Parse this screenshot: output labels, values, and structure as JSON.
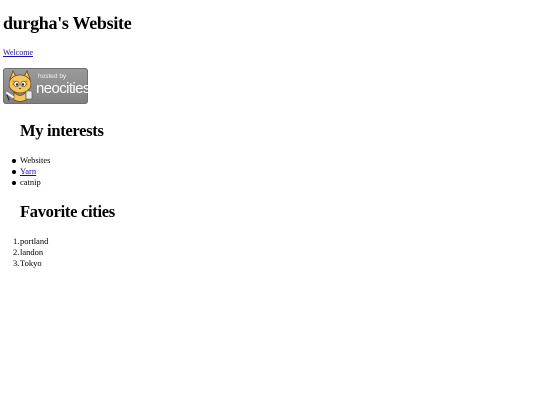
{
  "site": {
    "title": "durgha's Website",
    "welcome_link": "Welcome"
  },
  "badge": {
    "hosted_text": "hosted by",
    "brand_text": "neocities",
    "icon": "neocities-cat-icon",
    "background": "#8c8c8c"
  },
  "interests": {
    "heading": "My interests",
    "items": [
      {
        "label": "Websites",
        "link": false
      },
      {
        "label": "Yarn",
        "link": true
      },
      {
        "label": "catnip",
        "link": false
      }
    ]
  },
  "cities": {
    "heading": "Favorite cities",
    "items": [
      {
        "number": "1.",
        "label": "portland"
      },
      {
        "number": "2.",
        "label": "landon"
      },
      {
        "number": "3.",
        "label": "Tokyo"
      }
    ]
  },
  "colors": {
    "link": "#1a0dab",
    "text": "#000000",
    "background": "#ffffff"
  }
}
